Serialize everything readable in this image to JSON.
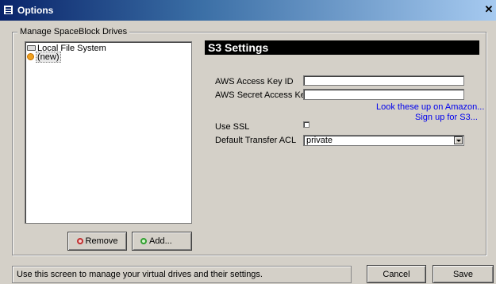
{
  "window": {
    "title": "Options"
  },
  "drives_group": {
    "legend": "Manage SpaceBlock Drives",
    "tree": [
      {
        "label": "Local File System",
        "icon": "drive-icon"
      },
      {
        "label": "(new)",
        "icon": "new-drive-icon"
      }
    ],
    "remove_label": "Remove",
    "add_label": "Add..."
  },
  "s3": {
    "header": "S3 Settings",
    "access_key_label": "AWS Access Key ID",
    "access_key_value": "",
    "secret_key_label": "AWS Secret Access Key",
    "secret_key_value": "",
    "lookup_link": "Look these up on Amazon...",
    "signup_link": "Sign up for S3...",
    "ssl_label": "Use SSL",
    "ssl_checked": false,
    "acl_label": "Default Transfer ACL",
    "acl_value": "private"
  },
  "status": {
    "text": "Use this screen to manage your virtual drives and their settings."
  },
  "footer": {
    "cancel_label": "Cancel",
    "save_label": "Save"
  },
  "colors": {
    "window_bg": "#d4d0c8",
    "title_bar": "#0a246a",
    "link": "#0000ee",
    "header_bg": "#000000"
  }
}
